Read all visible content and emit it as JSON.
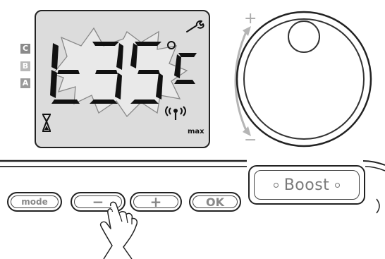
{
  "display": {
    "mode_letters": [
      "C",
      "B",
      "A"
    ],
    "prefix": "t",
    "temperature": "35",
    "unit": "C",
    "level": "max",
    "icons": [
      "wrench-icon",
      "hourglass-icon",
      "wireless-signal-icon",
      "starburst-blink-icon"
    ]
  },
  "knob": {
    "plus": "+",
    "minus": "−"
  },
  "buttons": {
    "mode": "mode",
    "minus": "−",
    "plus": "+",
    "ok": "OK",
    "boost": "Boost"
  },
  "colors": {
    "lcd_bg": "#dcdcdc",
    "mode_c": "#8a8a8a",
    "mode_b": "#b8b8b8",
    "mode_a": "#9a9a9a",
    "knob_arrow": "#b5b5b5"
  }
}
